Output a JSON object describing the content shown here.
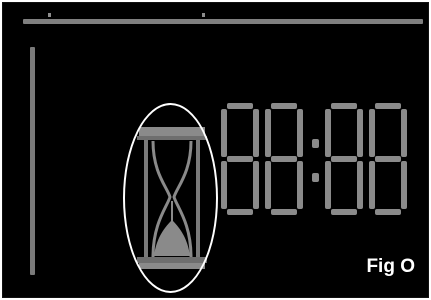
{
  "figure": {
    "label": "Fig O"
  },
  "display": {
    "time_digits": "88:88",
    "indicator": "hourglass-icon",
    "segment_color": "#8a8a8a",
    "highlight_color": "#ffffff",
    "background": "#000000"
  }
}
